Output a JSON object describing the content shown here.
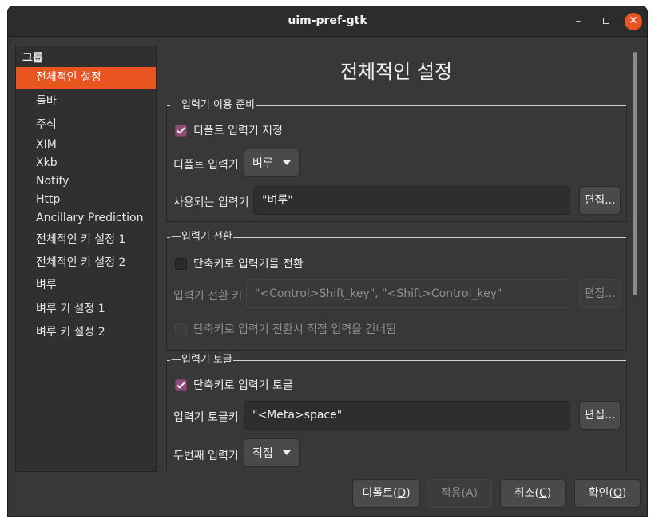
{
  "window": {
    "title": "uim-pref-gtk",
    "min_glyph": "–",
    "close_glyph": "✕"
  },
  "sidebar": {
    "header": "그룹",
    "items": [
      {
        "label": "전체적인 설정",
        "selected": true
      },
      {
        "label": "툴바"
      },
      {
        "label": "주석"
      },
      {
        "label": "XIM"
      },
      {
        "label": "Xkb"
      },
      {
        "label": "Notify"
      },
      {
        "label": "Http"
      },
      {
        "label": "Ancillary Prediction"
      },
      {
        "label": "전체적인 키 설정 1"
      },
      {
        "label": "전체적인 키 설정 2"
      },
      {
        "label": "벼루"
      },
      {
        "label": "벼루 키 설정 1"
      },
      {
        "label": "벼루 키 설정 2"
      }
    ]
  },
  "main": {
    "title": "전체적인 설정",
    "section1": {
      "title": "입력기 이용 준비",
      "default_check_label": "디폴트 입력기 지정",
      "default_checked": true,
      "default_im_label": "디폴트 입력기",
      "default_im_value": "벼루",
      "enabled_im_label": "사용되는 입력기",
      "enabled_im_value": "\"벼루\"",
      "edit_label": "편집..."
    },
    "section2": {
      "title": "입력기 전환",
      "switch_check_label": "단축키로 입력기를 전환",
      "switch_checked": false,
      "switch_key_label": "입력기 전환 키",
      "switch_key_value": "\"<Control>Shift_key\", \"<Shift>Control_key\"",
      "edit_label": "편집...",
      "skip_check_label": "단축키로 입력기 전환시 직접 입력을 건너뜀",
      "skip_checked": false
    },
    "section3": {
      "title": "입력기 토글",
      "toggle_check_label": "단축키로 입력기 토글",
      "toggle_checked": true,
      "toggle_key_label": "입력기 토글키",
      "toggle_key_value": "\"<Meta>space\"",
      "edit_label": "편집...",
      "second_im_label": "두번째 입력기",
      "second_im_value": "직접"
    }
  },
  "footer": {
    "default_label": "디폴트(",
    "default_mnemonic": "D",
    "apply_label": "적용(A)",
    "cancel_label": "취소(",
    "cancel_mnemonic": "C",
    "ok_label": "확인(",
    "ok_mnemonic": "O",
    "close_paren": ")"
  },
  "colors": {
    "accent": "#e95420",
    "checkbox_checked": "#8e4b78",
    "window_bg": "#383838"
  }
}
